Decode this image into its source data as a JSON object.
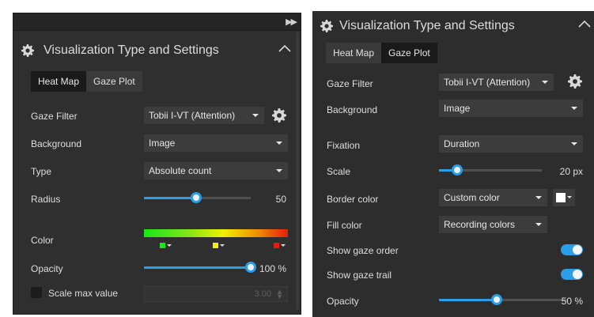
{
  "left_panel": {
    "title": "Visualization Type and Settings",
    "collapse_icon": "double-chevron-right-icon",
    "tabs": [
      {
        "label": "Heat Map"
      },
      {
        "label": "Gaze Plot"
      }
    ],
    "gaze_filter": {
      "label": "Gaze Filter",
      "value": "Tobii I-VT (Attention)"
    },
    "background": {
      "label": "Background",
      "value": "Image"
    },
    "type": {
      "label": "Type",
      "value": "Absolute count"
    },
    "radius": {
      "label": "Radius",
      "value": "50",
      "level": 0.49
    },
    "color": {
      "label": "Color",
      "stops": [
        {
          "color": "#19e619"
        },
        {
          "color": "#f0f000"
        },
        {
          "color": "#e81a10"
        }
      ]
    },
    "opacity": {
      "label": "Opacity",
      "value": "100 %",
      "level": 1.0
    },
    "scale_max": {
      "label": "Scale max value",
      "value": "3.00",
      "checked": false
    }
  },
  "right_panel": {
    "title": "Visualization Type and Settings",
    "tabs": [
      {
        "label": "Heat Map"
      },
      {
        "label": "Gaze Plot"
      }
    ],
    "gaze_filter": {
      "label": "Gaze Filter",
      "value": "Tobii I-VT (Attention)"
    },
    "background": {
      "label": "Background",
      "value": "Image"
    },
    "fixation": {
      "label": "Fixation",
      "value": "Duration"
    },
    "scale": {
      "label": "Scale",
      "value": "20 px",
      "level": 0.18
    },
    "border_color": {
      "label": "Border color",
      "value": "Custom color",
      "swatch": "#ffffff"
    },
    "fill_color": {
      "label": "Fill color",
      "value": "Recording colors"
    },
    "show_gaze_order": {
      "label": "Show gaze order",
      "on": true
    },
    "show_gaze_trail": {
      "label": "Show gaze trail",
      "on": true
    },
    "opacity": {
      "label": "Opacity",
      "value": "50 %",
      "level": 0.45
    }
  },
  "colors": {
    "accent": "#2a9ee8",
    "panel": "#2f2f2f",
    "tab_active": "#1a1a1a"
  }
}
